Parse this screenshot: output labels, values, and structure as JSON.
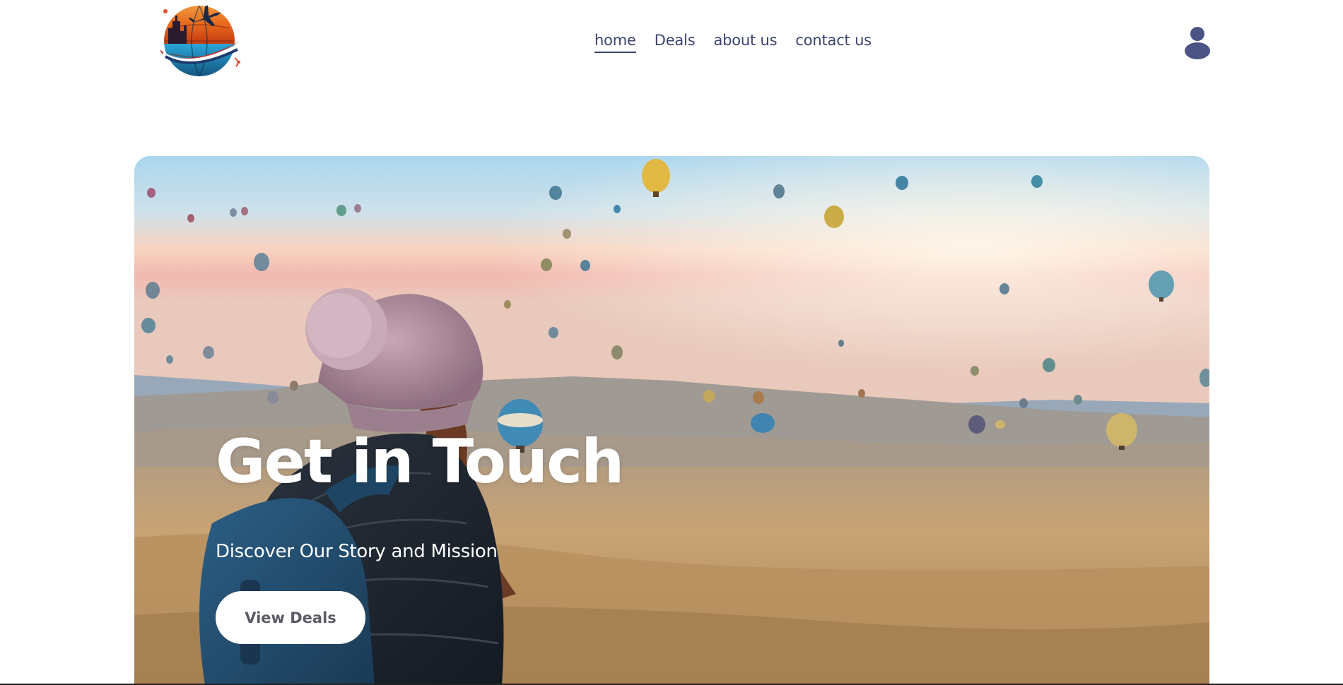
{
  "nav": {
    "items": [
      {
        "label": "home",
        "active": true
      },
      {
        "label": "Deals",
        "active": false
      },
      {
        "label": "about us",
        "active": false
      },
      {
        "label": "contact us",
        "active": false
      }
    ]
  },
  "hero": {
    "title": "Get in Touch",
    "subtitle": "Discover Our Story and Mission",
    "button_label": "View Deals"
  },
  "colors": {
    "nav_text": "#3b4470",
    "user_icon": "#4a5383",
    "hero_text": "#ffffff",
    "button_bg": "#ffffff",
    "button_text": "#5a5a66"
  },
  "icons": {
    "logo": "travel-globe-airplane-logo",
    "user": "user-icon"
  }
}
